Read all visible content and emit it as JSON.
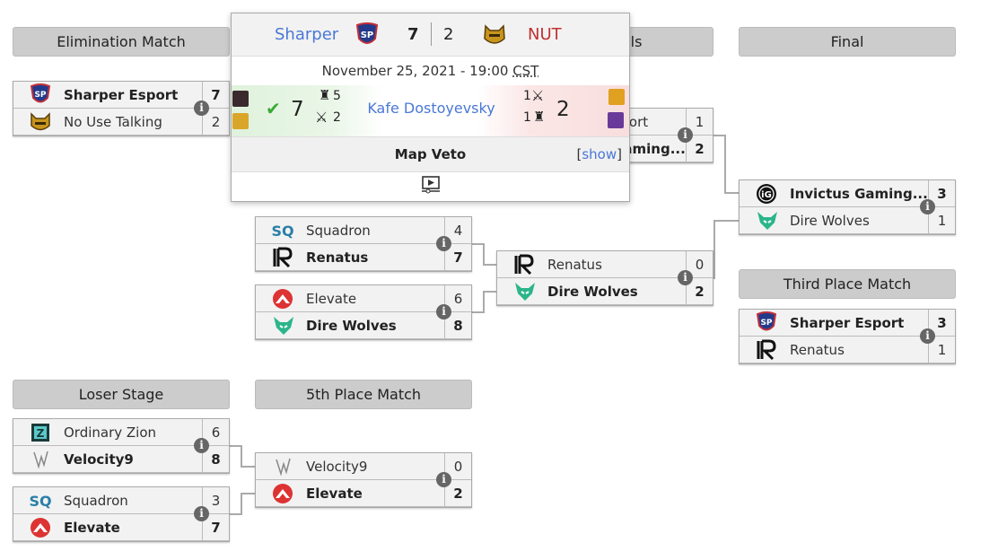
{
  "colors": {
    "link": "#4a78d6",
    "loser": "#c03030",
    "win_check": "#3aaa35"
  },
  "headers": {
    "elimination": "Elimination Match",
    "semifinals": "Semifinals",
    "final": "Final",
    "third": "Third Place Match",
    "loser": "Loser Stage",
    "fifth": "5th Place Match"
  },
  "matches": {
    "elim": [
      {
        "team": "Sharper Esport",
        "score": "7",
        "win": true,
        "logo": "sharper"
      },
      {
        "team": "No Use Talking",
        "score": "2",
        "win": false,
        "logo": "nut"
      }
    ],
    "semi1": [
      {
        "team": "Sharper Esport",
        "score": "1",
        "win": false,
        "logo": "sharper"
      },
      {
        "team": "Invictus Gaming...",
        "score": "2",
        "win": true,
        "logo": "ig"
      }
    ],
    "qf1": [
      {
        "team": "Squadron",
        "score": "4",
        "win": false,
        "logo": "squadron"
      },
      {
        "team": "Renatus",
        "score": "7",
        "win": true,
        "logo": "renatus"
      }
    ],
    "qf2": [
      {
        "team": "Elevate",
        "score": "6",
        "win": false,
        "logo": "elevate"
      },
      {
        "team": "Dire Wolves",
        "score": "8",
        "win": true,
        "logo": "direwolves"
      }
    ],
    "semi2": [
      {
        "team": "Renatus",
        "score": "0",
        "win": false,
        "logo": "renatus"
      },
      {
        "team": "Dire Wolves",
        "score": "2",
        "win": true,
        "logo": "direwolves"
      }
    ],
    "final": [
      {
        "team": "Invictus Gaming...",
        "score": "3",
        "win": true,
        "logo": "ig"
      },
      {
        "team": "Dire Wolves",
        "score": "1",
        "win": false,
        "logo": "direwolves"
      }
    ],
    "third": [
      {
        "team": "Sharper Esport",
        "score": "3",
        "win": true,
        "logo": "sharper"
      },
      {
        "team": "Renatus",
        "score": "1",
        "win": false,
        "logo": "renatus"
      }
    ],
    "ls1": [
      {
        "team": "Ordinary Zion",
        "score": "6",
        "win": false,
        "logo": "zion"
      },
      {
        "team": "Velocity9",
        "score": "8",
        "win": true,
        "logo": "velocity"
      }
    ],
    "ls2": [
      {
        "team": "Squadron",
        "score": "3",
        "win": false,
        "logo": "squadron"
      },
      {
        "team": "Elevate",
        "score": "7",
        "win": true,
        "logo": "elevate"
      }
    ],
    "fifth": [
      {
        "team": "Velocity9",
        "score": "0",
        "win": false,
        "logo": "velocity"
      },
      {
        "team": "Elevate",
        "score": "2",
        "win": true,
        "logo": "elevate"
      }
    ]
  },
  "popup": {
    "team1": "Sharper",
    "team2": "NUT",
    "score1": "7",
    "score2": "2",
    "date": "November 25, 2021 - 19:00 ",
    "tz": "CST",
    "map": "Kafe Dostoyevsky",
    "map_score1": "7",
    "map_score2": "2",
    "t1_defense": "5",
    "t1_attack": "2",
    "t2_attack": "1",
    "t2_defense": "1",
    "veto_label": "Map Veto",
    "show_label": "show"
  }
}
